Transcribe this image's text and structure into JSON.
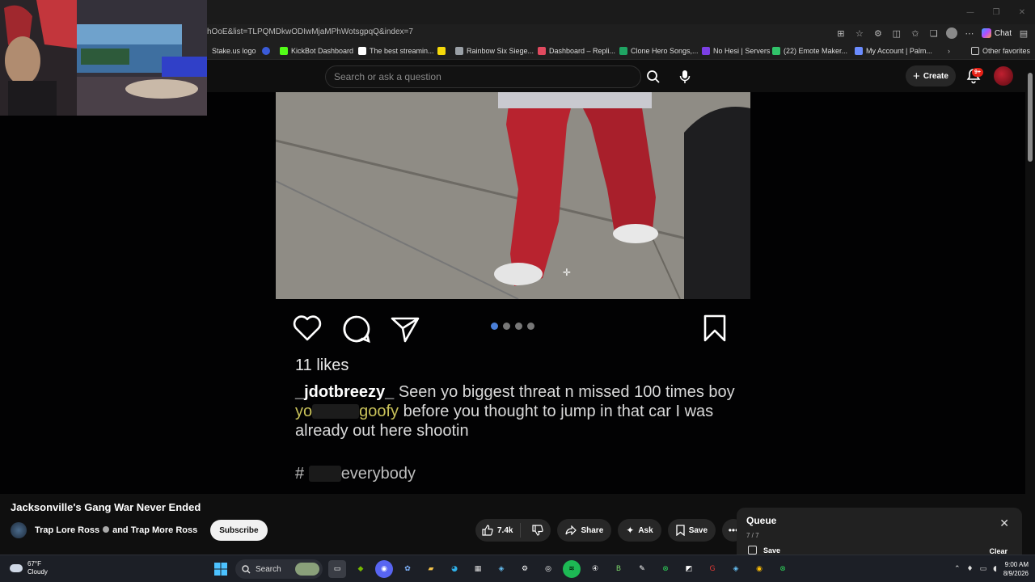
{
  "browser": {
    "url": "hOoE&list=TLPQMDkwODIwMjaMPhWotsgpqQ&index=7",
    "copilot_label": "Chat",
    "bookmarks": [
      {
        "label": "Stake.us logo",
        "color": "#1a2c38"
      },
      {
        "label": "",
        "color": "#3a5bd9"
      },
      {
        "label": "KickBot Dashboard",
        "color": "#53fc18"
      },
      {
        "label": "The best streamin...",
        "color": "#ffffff"
      },
      {
        "label": "",
        "color": "#f5d90a"
      },
      {
        "label": "Rainbow Six Siege...",
        "color": "#9aa0a6"
      },
      {
        "label": "Dashboard – Repli...",
        "color": "#e04a5f"
      },
      {
        "label": "Clone Hero Songs,...",
        "color": "#1fa463"
      },
      {
        "label": "No Hesi | Servers",
        "color": "#7b3fe4"
      },
      {
        "label": "(22) Emote Maker...",
        "color": "#31c36a"
      },
      {
        "label": "My Account | Palm...",
        "color": "#6b8cff"
      }
    ],
    "other_favorites": "Other favorites"
  },
  "youtube": {
    "search_placeholder": "Search or ask a question",
    "create_label": "Create",
    "notif_badge": "9+"
  },
  "video_frame": {
    "likes": "11 likes",
    "username": "_jdotbreezy_",
    "caption_part1": "Seen yo biggest threat n missed 100 times boy",
    "caption_yo": "yo",
    "caption_goofy": "goofy",
    "caption_part2": "before you thought to jump in that car I was already out here shootin",
    "hashtag_prefix": "#",
    "hashtag_suffix": "everybody"
  },
  "video": {
    "title": "Jacksonville's Gang War Never Ended",
    "channel": "Trap Lore Ross",
    "channel_suffix": "and Trap More Ross",
    "subscribe_label": "Subscribe",
    "like_count": "7.4k",
    "share_label": "Share",
    "ask_label": "Ask",
    "save_label": "Save"
  },
  "queue": {
    "title": "Queue",
    "count": "7 / 7",
    "save_label": "Save",
    "clear_label": "Clear"
  },
  "taskbar": {
    "temp": "67°F",
    "condition": "Cloudy",
    "search_label": "Search",
    "time": "9:00 AM",
    "date": "8/9/2026"
  }
}
